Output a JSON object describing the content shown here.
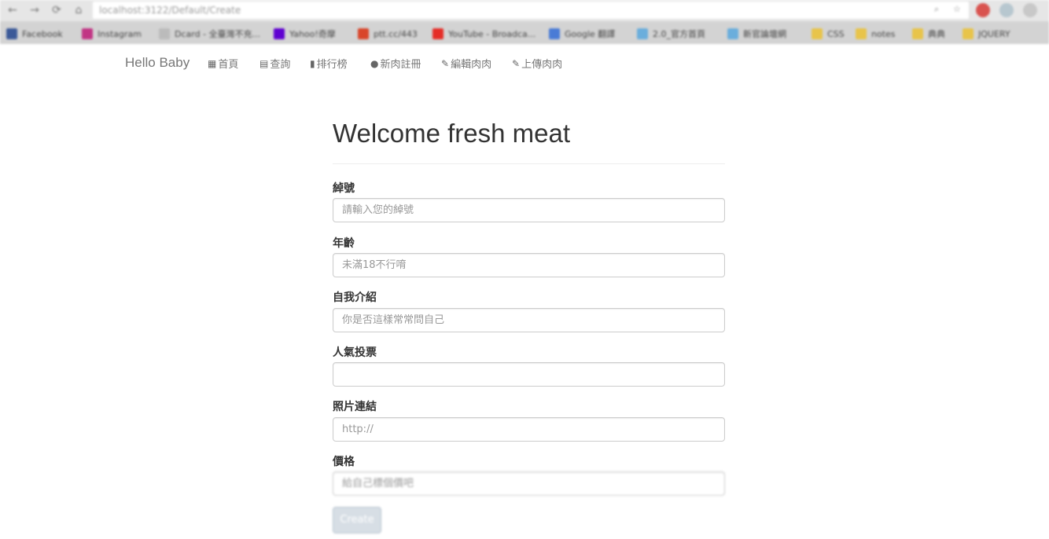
{
  "browser": {
    "address": "localhost:3122/Default/Create",
    "bookmarks": [
      {
        "label": "Facebook",
        "color": "#3b5998"
      },
      {
        "label": "Instagram",
        "color": "#c13584"
      },
      {
        "label": "Dcard - 全臺灣不充...",
        "color": "#bbbbbb"
      },
      {
        "label": "Yahoo!奇摩",
        "color": "#5f01d1"
      },
      {
        "label": "ptt.cc/443",
        "color": "#d9452a"
      },
      {
        "label": "YouTube - Broadca...",
        "color": "#e52d27"
      },
      {
        "label": "Google 翻譯",
        "color": "#4a7bd6"
      },
      {
        "label": "2.0_官方首頁",
        "color": "#6aaedc"
      },
      {
        "label": "新官論壇網",
        "color": "#6aaedc"
      },
      {
        "label": "CSS",
        "color": "#e8c44a"
      },
      {
        "label": "notes",
        "color": "#e8c44a"
      },
      {
        "label": "典典",
        "color": "#e8c44a"
      },
      {
        "label": "JQUERY",
        "color": "#e8c44a"
      }
    ]
  },
  "navbar": {
    "brand": "Hello Baby",
    "items": [
      {
        "icon": "th-icon",
        "glyph": "▦",
        "label": "首頁"
      },
      {
        "icon": "list-alt-icon",
        "glyph": "▤",
        "label": "查詢"
      },
      {
        "icon": "stats-icon",
        "glyph": "▮",
        "label": "排行榜"
      },
      {
        "icon": "user-icon",
        "glyph": "●",
        "label": "新肉註冊"
      },
      {
        "icon": "pencil-icon",
        "glyph": "✎",
        "label": "編輯肉肉"
      },
      {
        "icon": "pencil-icon",
        "glyph": "✎",
        "label": "上傳肉肉"
      }
    ]
  },
  "form": {
    "title": "Welcome fresh meat",
    "fields": [
      {
        "label": "綽號",
        "placeholder": "請輸入您的綽號"
      },
      {
        "label": "年齡",
        "placeholder": "未滿18不行唷"
      },
      {
        "label": "自我介紹",
        "placeholder": "你是否這樣常常問自己"
      },
      {
        "label": "人氣投票",
        "placeholder": ""
      },
      {
        "label": "照片連結",
        "placeholder": "http://"
      },
      {
        "label": "價格",
        "placeholder": "給自己標個價吧"
      }
    ],
    "submit_label": "Create"
  },
  "colors": {
    "nav_text": "#777777",
    "title_text": "#333333",
    "input_border": "#cccccc",
    "button_bg": "#d7dee5"
  }
}
